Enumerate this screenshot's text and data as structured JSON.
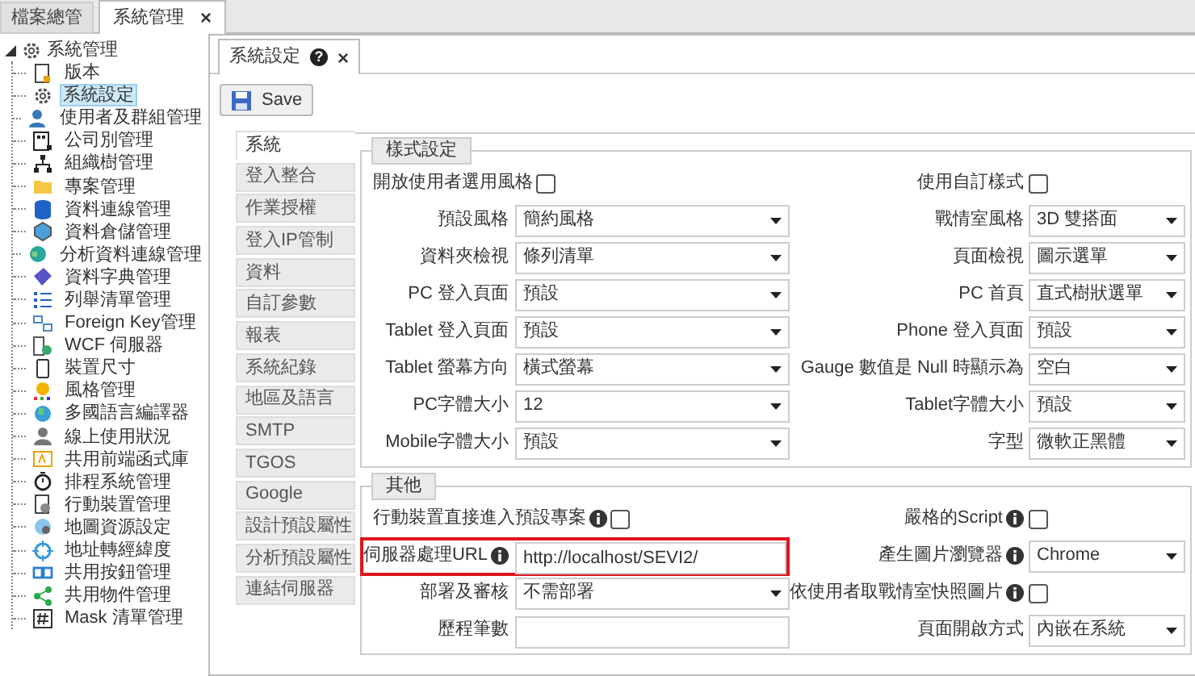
{
  "top_tabs": [
    {
      "label": "檔案總管",
      "selected": false
    },
    {
      "label": "系統管理",
      "selected": true,
      "close": "×"
    }
  ],
  "tree": {
    "label": "系統管理",
    "expanded": true,
    "children": [
      {
        "label": "版本",
        "selected": false
      },
      {
        "label": "系統設定",
        "selected": true
      },
      {
        "label": "使用者及群組管理",
        "selected": false
      },
      {
        "label": "公司別管理",
        "selected": false
      },
      {
        "label": "組織樹管理",
        "selected": false
      },
      {
        "label": "專案管理",
        "selected": false
      },
      {
        "label": "資料連線管理",
        "selected": false
      },
      {
        "label": "資料倉儲管理",
        "selected": false
      },
      {
        "label": "分析資料連線管理",
        "selected": false
      },
      {
        "label": "資料字典管理",
        "selected": false
      },
      {
        "label": "列舉清單管理",
        "selected": false
      },
      {
        "label": "Foreign Key管理",
        "selected": false
      },
      {
        "label": "WCF 伺服器",
        "selected": false
      },
      {
        "label": "裝置尺寸",
        "selected": false
      },
      {
        "label": "風格管理",
        "selected": false
      },
      {
        "label": "多國語言編譯器",
        "selected": false
      },
      {
        "label": "線上使用狀況",
        "selected": false
      },
      {
        "label": "共用前端函式庫",
        "selected": false
      },
      {
        "label": "排程系統管理",
        "selected": false
      },
      {
        "label": "行動裝置管理",
        "selected": false
      },
      {
        "label": "地圖資源設定",
        "selected": false
      },
      {
        "label": "地址轉經緯度",
        "selected": false
      },
      {
        "label": "共用按鈕管理",
        "selected": false
      },
      {
        "label": "共用物件管理",
        "selected": false
      },
      {
        "label": "Mask 清單管理",
        "selected": false
      }
    ]
  },
  "doc_tab": {
    "label": "系統設定",
    "help": "?",
    "close": "×"
  },
  "save_button": {
    "label": "Save"
  },
  "side_tabs": [
    {
      "label": "系統",
      "selected": true
    },
    {
      "label": "登入整合",
      "selected": false
    },
    {
      "label": "作業授權",
      "selected": false
    },
    {
      "label": "登入IP管制",
      "selected": false
    },
    {
      "label": "資料",
      "selected": false
    },
    {
      "label": "自訂參數",
      "selected": false
    },
    {
      "label": "報表",
      "selected": false
    },
    {
      "label": "系統紀錄",
      "selected": false
    },
    {
      "label": "地區及語言",
      "selected": false
    },
    {
      "label": "SMTP",
      "selected": false
    },
    {
      "label": "TGOS",
      "selected": false
    },
    {
      "label": "Google",
      "selected": false
    },
    {
      "label": "設計預設屬性",
      "selected": false
    },
    {
      "label": "分析預設屬性",
      "selected": false
    },
    {
      "label": "連結伺服器",
      "selected": false
    }
  ],
  "sections": [
    {
      "legend": "樣式設定",
      "rows": [
        [
          {
            "kind": "checkbox",
            "label": "開放使用者選用風格",
            "checked": false
          },
          {
            "kind": "checkbox",
            "label": "使用自訂樣式",
            "checked": false
          }
        ],
        [
          {
            "kind": "select",
            "label": "預設風格",
            "value": "簡約風格"
          },
          {
            "kind": "select",
            "label": "戰情室風格",
            "value": "3D 雙搭面"
          }
        ],
        [
          {
            "kind": "select",
            "label": "資料夾檢視",
            "value": "條列清單"
          },
          {
            "kind": "select",
            "label": "頁面檢視",
            "value": "圖示選單"
          }
        ],
        [
          {
            "kind": "select",
            "label": "PC 登入頁面",
            "value": "預設"
          },
          {
            "kind": "select",
            "label": "PC 首頁",
            "value": "直式樹狀選單"
          }
        ],
        [
          {
            "kind": "select",
            "label": "Tablet 登入頁面",
            "value": "預設"
          },
          {
            "kind": "select",
            "label": "Phone 登入頁面",
            "value": "預設"
          }
        ],
        [
          {
            "kind": "select",
            "label": "Tablet 螢幕方向",
            "value": "橫式螢幕"
          },
          {
            "kind": "select",
            "label": "Gauge 數值是 Null 時顯示為",
            "value": "空白"
          }
        ],
        [
          {
            "kind": "select",
            "label": "PC字體大小",
            "value": "12"
          },
          {
            "kind": "select",
            "label": "Tablet字體大小",
            "value": "預設"
          }
        ],
        [
          {
            "kind": "select",
            "label": "Mobile字體大小",
            "value": "預設"
          },
          {
            "kind": "select",
            "label": "字型",
            "value": "微軟正黑體"
          }
        ]
      ]
    },
    {
      "legend": "其他",
      "rows": [
        [
          {
            "kind": "checkbox",
            "label": "行動裝置直接進入預設專案",
            "info": true,
            "checked": false
          },
          {
            "kind": "checkbox",
            "label": "嚴格的Script",
            "info": true,
            "checked": false
          }
        ],
        [
          {
            "kind": "text",
            "label": "伺服器處理URL",
            "info": true,
            "value": "http://localhost/SEVI2/",
            "highlighted": true
          },
          {
            "kind": "select",
            "label": "產生圖片瀏覽器",
            "info": true,
            "value": "Chrome"
          }
        ],
        [
          {
            "kind": "select",
            "label": "部署及審核",
            "value": "不需部署"
          },
          {
            "kind": "checkbox",
            "label": "依使用者取戰情室快照圖片",
            "info": true,
            "checked": false
          }
        ],
        [
          {
            "kind": "text",
            "label": "歷程筆數"
          },
          {
            "kind": "select",
            "label": "頁面開啟方式",
            "value": "內嵌在系統"
          }
        ]
      ]
    }
  ]
}
